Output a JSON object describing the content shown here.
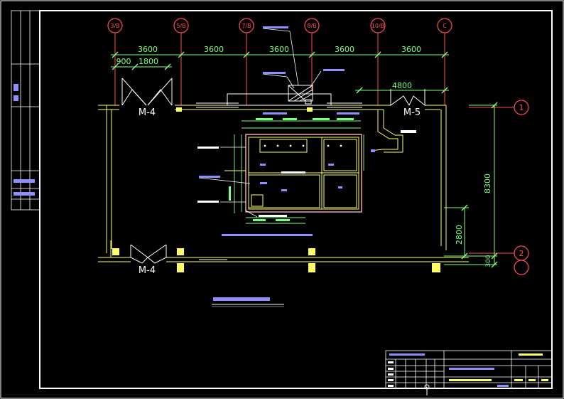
{
  "axes": {
    "top": [
      "3/B",
      "5/B",
      "7/B",
      "8/B",
      "10/B",
      "C"
    ],
    "right": [
      "1",
      "2"
    ]
  },
  "dimensions": {
    "top_spans": [
      "3600",
      "3600",
      "3600",
      "3600",
      "3600"
    ],
    "sub_spans": [
      "900",
      "1800"
    ],
    "right_span": "4800",
    "vertical_total": "8300",
    "vertical_lower": "2800",
    "vertical_small": "300"
  },
  "doors": {
    "top_left": "M-4",
    "top_right": "M-5",
    "bottom_left": "M-4"
  },
  "colors": {
    "background": "#000000",
    "frame": "#ffffff",
    "walls": "#ffff66",
    "dimension": "#7dff7d",
    "axis": "#ff4d4d",
    "annotation": "#8f8fff",
    "pit_outline": "#ffb0b0"
  }
}
